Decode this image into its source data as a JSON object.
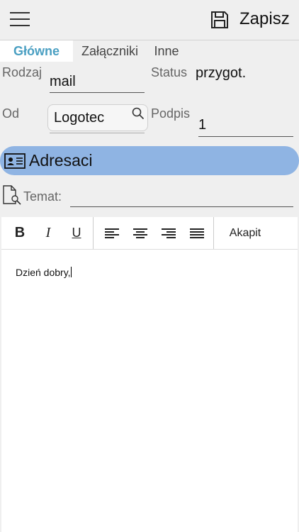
{
  "header": {
    "save_label": "Zapisz"
  },
  "tabs": [
    {
      "label": "Główne",
      "active": true
    },
    {
      "label": "Załączniki",
      "active": false
    },
    {
      "label": "Inne",
      "active": false
    }
  ],
  "form": {
    "type_label": "Rodzaj",
    "type_value": "mail",
    "status_label": "Status",
    "status_value": "przygot.",
    "from_label": "Od",
    "from_value": "Logotec",
    "signature_label": "Podpis",
    "signature_value": "1",
    "recipients_label": "Adresaci",
    "subject_placeholder": "Temat:",
    "subject_value": ""
  },
  "toolbar": {
    "bold": "B",
    "italic": "I",
    "underline": "U",
    "paragraph_label": "Akapit"
  },
  "editor": {
    "text": "Dzień dobry,"
  },
  "colors": {
    "accent": "#4a9fc2",
    "recipients_bar": "#8fb4e3"
  }
}
